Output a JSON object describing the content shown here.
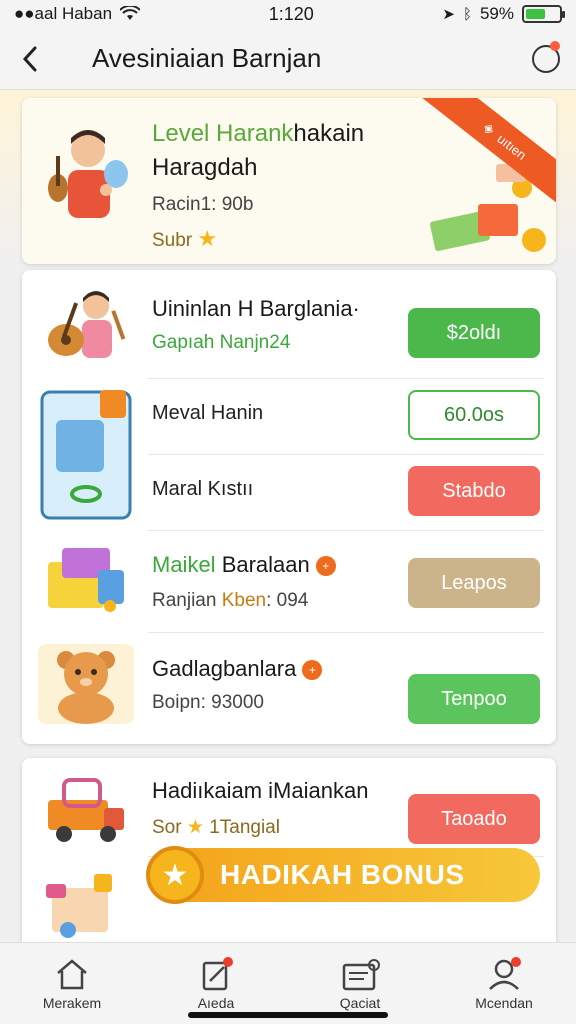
{
  "status": {
    "carrier": "●●aal Haban",
    "time": "1:120",
    "battery_pct": "59%",
    "battery_level": 0.59,
    "battery_color": "#3ec13e"
  },
  "header": {
    "back_icon": "chevron-left-icon",
    "title": "Avesiniaian Barnjan",
    "action_icon": "notification-circle-icon"
  },
  "hero": {
    "title_green": "Level Harank",
    "title_rest": "hakain",
    "title2": "Haragdah",
    "subtitle": "Racin1: 90b",
    "star_label": "Subr",
    "ribbon_text": "uıtıen",
    "accent": "#ee5a24"
  },
  "list": {
    "items": [
      {
        "title": "Uininlan H Barglania·",
        "subtitle": "Gapıah Nanjn24",
        "subtitle_color": "#3aa83a",
        "button": "$2oldı",
        "button_style": "green",
        "thumb": "guitar-boy-icon"
      },
      {
        "title": "",
        "subtitle": "Meval Hanin",
        "button": "60.0os",
        "button_style": "outline",
        "thumb": "phone-app-icon"
      },
      {
        "title": "",
        "subtitle": "Maral Kıstıı",
        "button": "Stabdo",
        "button_style": "red",
        "thumb": "phone-app-icon"
      },
      {
        "title_green": "Maikel",
        "title_rest": " Baralaan",
        "subtitle_pre": "Ranjian ",
        "subtitle_accent": "Kben",
        "subtitle_post": ": 094",
        "button": "Leapos",
        "button_style": "tan",
        "thumb": "toy-box-icon"
      },
      {
        "title": "Gadlagbanlara",
        "subtitle": "Boipn: 93000",
        "button": "Tenpoo",
        "button_style": "lightgreen",
        "thumb": "teddy-bear-icon"
      }
    ]
  },
  "list2": {
    "items": [
      {
        "title": "Hadiıkaiam iMaiankan",
        "subtitle_pre": "Sor",
        "subtitle_post": "1Tangial",
        "button": "Taoado",
        "button_style": "red",
        "thumb": "toy-truck-icon"
      }
    ],
    "bonus_text": "HADIKAH BONUS"
  },
  "tabs": [
    {
      "label": "Merakem",
      "icon": "home-icon"
    },
    {
      "label": "Aıeda",
      "icon": "edit-icon"
    },
    {
      "label": "Qaciat",
      "icon": "card-icon"
    },
    {
      "label": "Mcendan",
      "icon": "profile-icon"
    }
  ]
}
